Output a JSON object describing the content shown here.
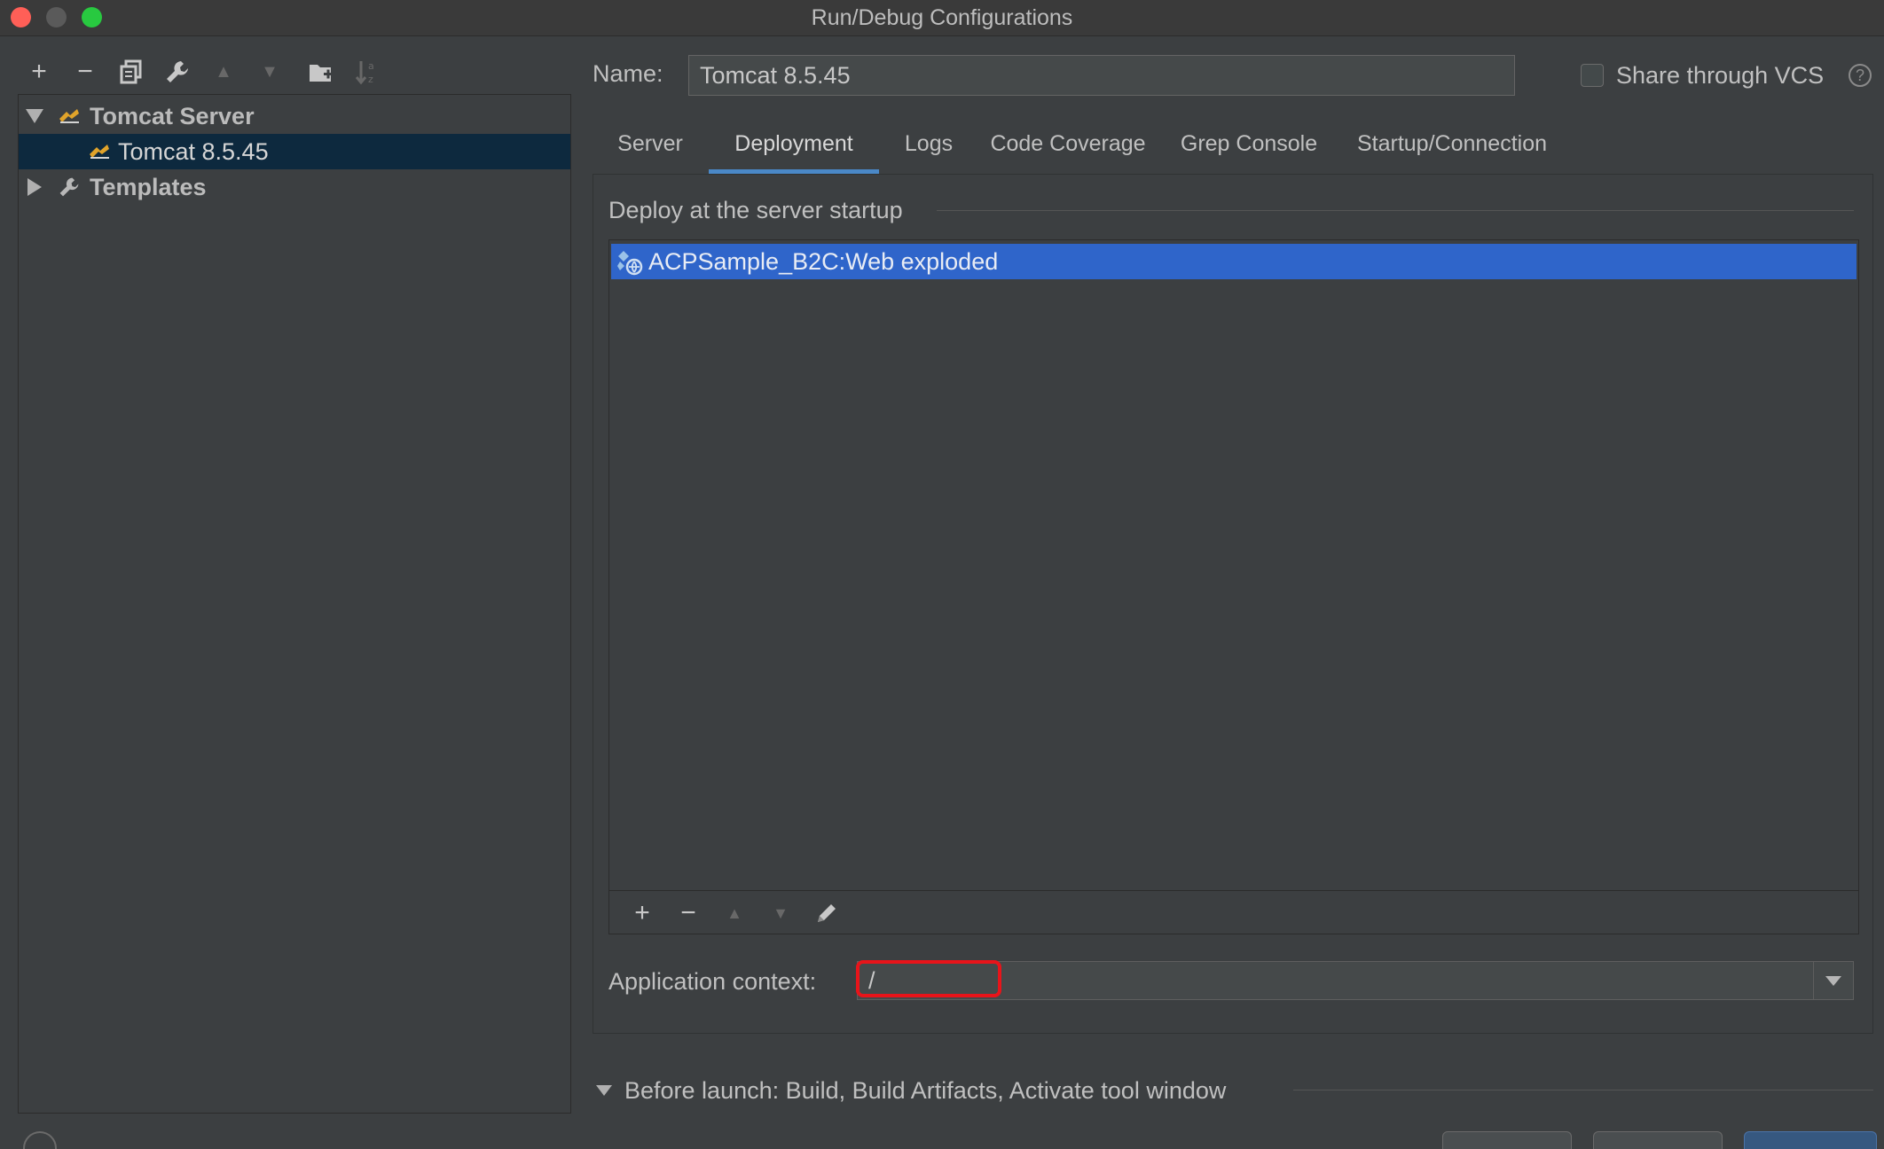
{
  "window": {
    "title": "Run/Debug Configurations"
  },
  "toolbar": {
    "buttons": [
      {
        "name": "add",
        "glyph": "+"
      },
      {
        "name": "remove",
        "glyph": "−"
      },
      {
        "name": "copy",
        "glyph": "⧉"
      },
      {
        "name": "edit-defaults",
        "glyph": "🔧"
      },
      {
        "name": "move-up",
        "glyph": "▲"
      },
      {
        "name": "move-down",
        "glyph": "▼"
      },
      {
        "name": "new-folder",
        "glyph": "📁"
      },
      {
        "name": "sort",
        "glyph": "↓ᵃ"
      }
    ]
  },
  "tree": {
    "items": [
      {
        "label": "Tomcat Server",
        "icon": "tomcat-icon",
        "expanded": true
      },
      {
        "label": "Tomcat 8.5.45",
        "icon": "tomcat-icon",
        "selected": true
      },
      {
        "label": "Templates",
        "icon": "wrench-icon",
        "expanded": false
      }
    ]
  },
  "config": {
    "name_label": "Name:",
    "name_value": "Tomcat 8.5.45",
    "share_label": "Share through VCS",
    "share_checked": false,
    "help_glyph": "?"
  },
  "tabs": [
    {
      "label": "Server",
      "active": false
    },
    {
      "label": "Deployment",
      "active": true
    },
    {
      "label": "Logs",
      "active": false
    },
    {
      "label": "Code Coverage",
      "active": false
    },
    {
      "label": "Grep Console",
      "active": false
    },
    {
      "label": "Startup/Connection",
      "active": false
    }
  ],
  "deployment": {
    "section_title": "Deploy at the server startup",
    "items": [
      {
        "label": "ACPSample_B2C:Web exploded",
        "icon": "artifact-icon",
        "selected": true
      }
    ],
    "list_toolbar": [
      {
        "name": "add",
        "glyph": "+"
      },
      {
        "name": "remove",
        "glyph": "−"
      },
      {
        "name": "move-up",
        "glyph": "▲"
      },
      {
        "name": "move-down",
        "glyph": "▼"
      },
      {
        "name": "edit",
        "glyph": "✎"
      }
    ],
    "context_label": "Application context:",
    "context_value": "/"
  },
  "before_launch": {
    "label": "Before launch: Build, Build Artifacts, Activate tool window"
  },
  "colors": {
    "selection": "#2f65ca",
    "tree_selection": "#0d293e",
    "tab_underline": "#4a88c7",
    "highlight": "#e8141a"
  }
}
